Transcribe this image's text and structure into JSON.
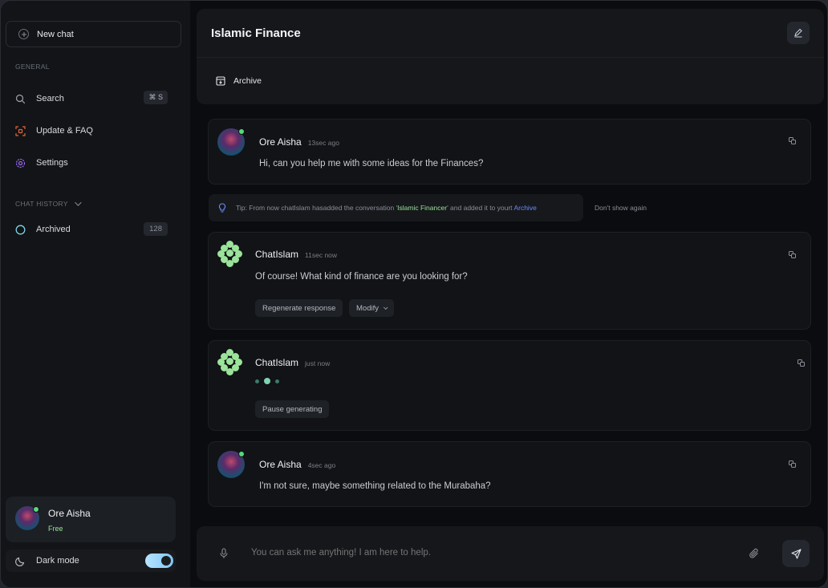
{
  "sidebar": {
    "new_chat": "New chat",
    "general_label": "GENERAL",
    "items": [
      {
        "label": "Search",
        "shortcut": "⌘ S",
        "icon": "search-icon"
      },
      {
        "label": "Update & FAQ",
        "icon": "scan-icon"
      },
      {
        "label": "Settings",
        "icon": "gear-icon"
      }
    ],
    "history_label": "CHAT HISTORY",
    "archived": {
      "label": "Archived",
      "count": "128"
    },
    "user": {
      "name": "Ore Aisha",
      "plan": "Free"
    },
    "dark_mode": {
      "label": "Dark mode",
      "enabled": true
    }
  },
  "header": {
    "title": "Islamic Finance",
    "archive_label": "Archive"
  },
  "messages": [
    {
      "author": "Ore Aisha",
      "time": "13sec ago",
      "text": "Hi, can you help me with some ideas for the Finances?"
    },
    {
      "author": "ChatIslam",
      "time": "11sec now",
      "text": "Of course! What kind of finance are you looking for?",
      "actions": [
        "Regenerate response",
        "Modify"
      ]
    },
    {
      "author": "ChatIslam",
      "time": "just now",
      "action": "Pause generating"
    },
    {
      "author": "Ore Aisha",
      "time": "4sec ago",
      "text": "I'm not sure, maybe something related to the Murabaha?"
    }
  ],
  "tip": {
    "prefix": "Tip: From now chatIslam hasadded the conversation '",
    "name": "Islamic Financer",
    "middle": "' and added it to yourt ",
    "link": "Archive",
    "dismiss": "Don't show again"
  },
  "composer": {
    "placeholder": "You can ask me anything! I am here to help."
  },
  "colors": {
    "accent_green": "#9be39a",
    "online": "#57d87a",
    "link_blue": "#6b8cf7",
    "toggle": "#7fc7f4"
  }
}
